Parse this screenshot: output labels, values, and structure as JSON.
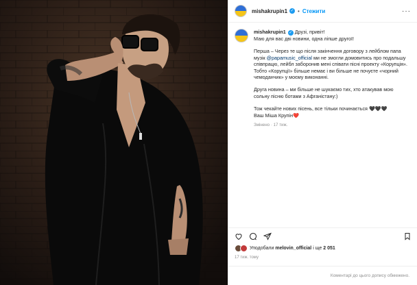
{
  "post": {
    "username": "mishakrupin1",
    "follow_label": "Стежити",
    "caption_username": "mishakrupin1",
    "caption_lines": [
      "Друзі, привіт!\nМаю для вас дві новини, одна лiпше другої!",
      "Перша – Через те що після закінчення договору з лейблом папа музік ",
      " ми не змогли домовитись про подальшу співпрацю, лейбл заборонив мені співати пісні проекту «Корупція». Тобто «Корупції» більше немає і ви більше не почуєте «чорний чемоданчик» у моєму виконанні.",
      "Друга новина – ми більше не шукаємо тих, хто атакував мою сольну пісню ботами з Афганістану:)",
      "Тож чекайте нових пісень, все тільки починається 🖤🖤🖤\nВаш Міша Крупін❤️"
    ],
    "mention": "@papamusic_official",
    "edited": "Змінено",
    "edited_ago": "17 тиж.",
    "likes_prefix": "Уподобали",
    "likes_user": "melovin_official",
    "likes_suffix": "і ще",
    "likes_count": "2 051",
    "time_ago": "17 тиж. тому",
    "comments_disabled": "Коментарі до цього допису обмежено."
  },
  "icons": [
    "verified-badge-icon",
    "more-options-icon",
    "heart-icon",
    "comment-icon",
    "share-icon",
    "bookmark-icon"
  ],
  "colors": {
    "link": "#0095f6",
    "mention": "#00376b",
    "muted": "#8e8e8e"
  }
}
